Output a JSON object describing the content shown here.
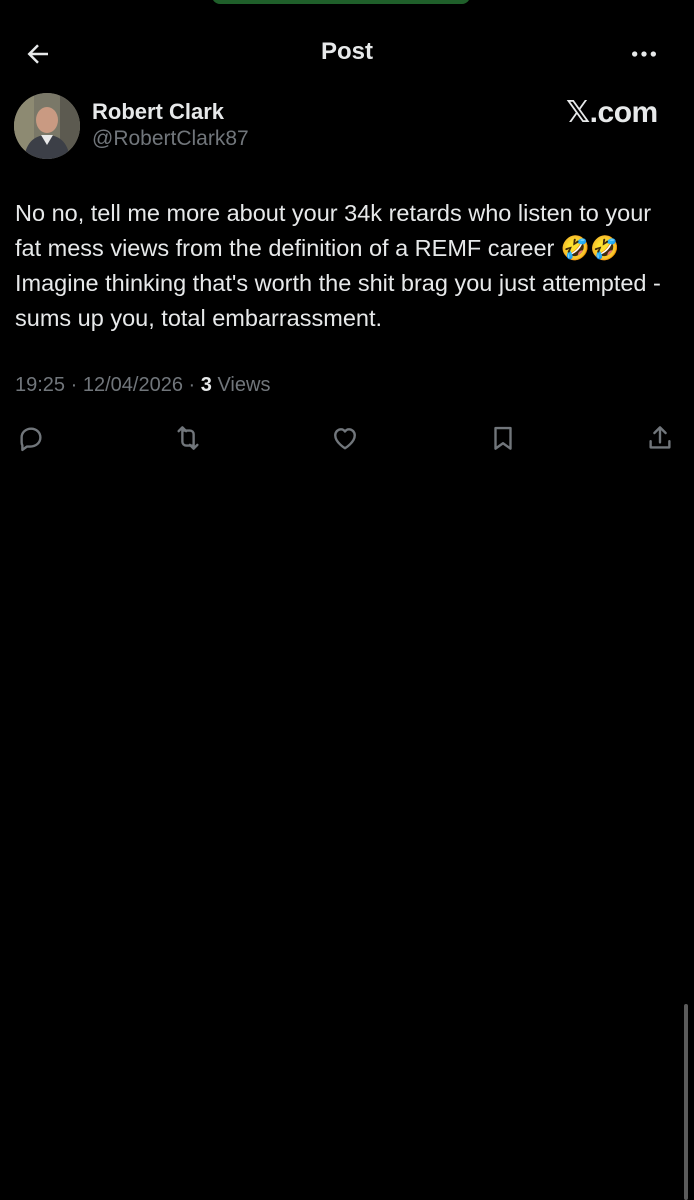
{
  "header": {
    "title": "Post",
    "back_icon": "arrow-left-icon",
    "more_icon": "more-horizontal-icon"
  },
  "post": {
    "author": {
      "name": "Robert Clark",
      "handle": "@RobertClark87",
      "avatar_icon": "avatar"
    },
    "brand": "𝕏.com",
    "text": "No no, tell me more about your 34k retards who listen to your fat mess views from the definition of a REMF career 🤣🤣 Imagine thinking that's worth the shit brag you just attempted - sums up you, total embarrassment.",
    "time": "19:25",
    "date": "12/04/2026",
    "separator": "·",
    "views_count": "3",
    "views_label": "Views"
  },
  "actions": {
    "reply_icon": "reply-icon",
    "repost_icon": "repost-icon",
    "like_icon": "like-icon",
    "bookmark_icon": "bookmark-icon",
    "share_icon": "share-icon"
  },
  "colors": {
    "background": "#000000",
    "text_primary": "#e7e9ea",
    "text_secondary": "#71767b",
    "status_accent": "#1f5f2a"
  }
}
